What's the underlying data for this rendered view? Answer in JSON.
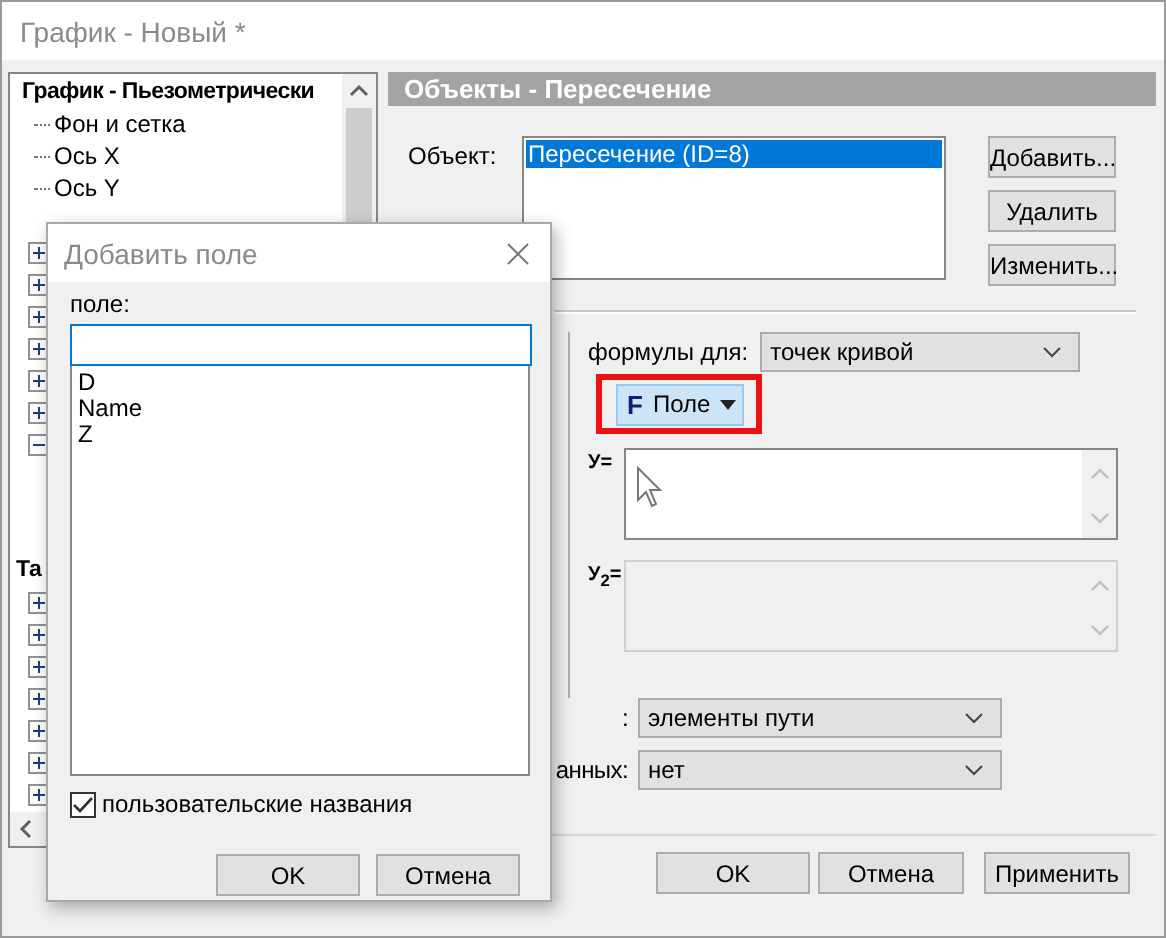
{
  "window": {
    "title": "График - Новый *"
  },
  "tree": {
    "root": {
      "label": "График - Пьезометрически",
      "children": [
        {
          "label": "Фон и сетка"
        },
        {
          "label": "Ось X"
        },
        {
          "label": "Ось Y"
        }
      ]
    },
    "groups": [
      {
        "nodes": [
          {
            "expanded": false
          },
          {
            "expanded": false
          },
          {
            "expanded": false
          },
          {
            "expanded": false
          },
          {
            "expanded": false
          },
          {
            "expanded": false
          },
          {
            "expanded": true
          }
        ]
      },
      {
        "label": "Та",
        "nodes": [
          {
            "expanded": false
          },
          {
            "expanded": false
          },
          {
            "expanded": false
          },
          {
            "expanded": false
          },
          {
            "expanded": false
          },
          {
            "expanded": false
          },
          {
            "expanded": false
          }
        ]
      }
    ]
  },
  "panel": {
    "header": "Объекты - Пересечение",
    "object_label": "Объект:",
    "objects": [
      {
        "label": "Пересечение (ID=8)",
        "selected": true
      }
    ],
    "buttons": [
      "Добавить...",
      "Удалить",
      "Изменить..."
    ],
    "formula_for_label": "формулы для:",
    "formula_for": "точек кривой",
    "field_button": {
      "icon_letter": "F",
      "label": "Поле",
      "highlighted": true
    },
    "formulas": [
      {
        "label": "У=",
        "disabled": false
      },
      {
        "label": "У$_{2}$=",
        "disabled": true
      }
    ],
    "settings": [
      {
        "label": ":",
        "value": "элементы пути"
      },
      {
        "label": "анных:",
        "value": "нет"
      }
    ]
  },
  "footer_buttons": [
    "OK",
    "Отмена",
    "Применить"
  ],
  "dialog": {
    "title": "Добавить поле",
    "field_label": "поле:",
    "fields": [
      "D",
      "Name",
      "Z"
    ],
    "custom_names": {
      "label": "пользовательские названия",
      "checked": true
    },
    "buttons": [
      "OK",
      "Отмена"
    ]
  }
}
